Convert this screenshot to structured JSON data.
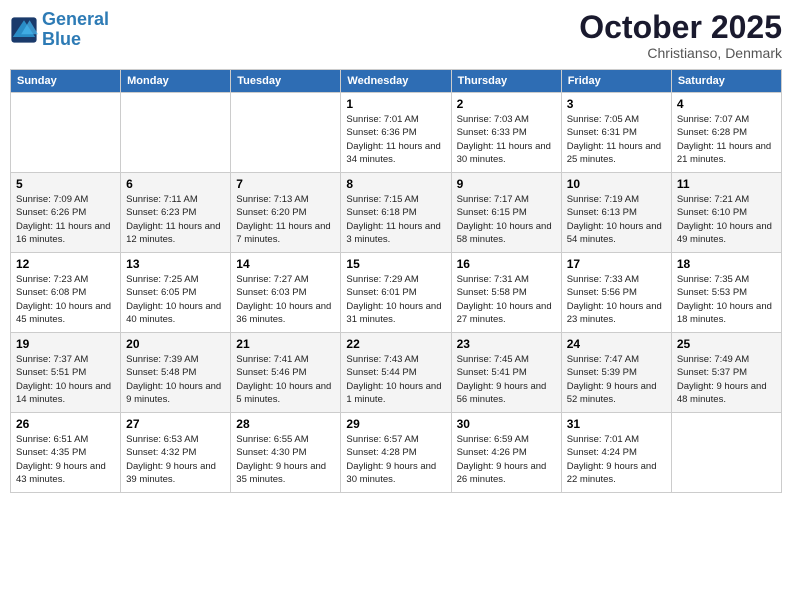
{
  "logo": {
    "line1": "General",
    "line2": "Blue"
  },
  "title": "October 2025",
  "subtitle": "Christianso, Denmark",
  "headers": [
    "Sunday",
    "Monday",
    "Tuesday",
    "Wednesday",
    "Thursday",
    "Friday",
    "Saturday"
  ],
  "weeks": [
    [
      {
        "day": "",
        "info": ""
      },
      {
        "day": "",
        "info": ""
      },
      {
        "day": "",
        "info": ""
      },
      {
        "day": "1",
        "info": "Sunrise: 7:01 AM\nSunset: 6:36 PM\nDaylight: 11 hours\nand 34 minutes."
      },
      {
        "day": "2",
        "info": "Sunrise: 7:03 AM\nSunset: 6:33 PM\nDaylight: 11 hours\nand 30 minutes."
      },
      {
        "day": "3",
        "info": "Sunrise: 7:05 AM\nSunset: 6:31 PM\nDaylight: 11 hours\nand 25 minutes."
      },
      {
        "day": "4",
        "info": "Sunrise: 7:07 AM\nSunset: 6:28 PM\nDaylight: 11 hours\nand 21 minutes."
      }
    ],
    [
      {
        "day": "5",
        "info": "Sunrise: 7:09 AM\nSunset: 6:26 PM\nDaylight: 11 hours\nand 16 minutes."
      },
      {
        "day": "6",
        "info": "Sunrise: 7:11 AM\nSunset: 6:23 PM\nDaylight: 11 hours\nand 12 minutes."
      },
      {
        "day": "7",
        "info": "Sunrise: 7:13 AM\nSunset: 6:20 PM\nDaylight: 11 hours\nand 7 minutes."
      },
      {
        "day": "8",
        "info": "Sunrise: 7:15 AM\nSunset: 6:18 PM\nDaylight: 11 hours\nand 3 minutes."
      },
      {
        "day": "9",
        "info": "Sunrise: 7:17 AM\nSunset: 6:15 PM\nDaylight: 10 hours\nand 58 minutes."
      },
      {
        "day": "10",
        "info": "Sunrise: 7:19 AM\nSunset: 6:13 PM\nDaylight: 10 hours\nand 54 minutes."
      },
      {
        "day": "11",
        "info": "Sunrise: 7:21 AM\nSunset: 6:10 PM\nDaylight: 10 hours\nand 49 minutes."
      }
    ],
    [
      {
        "day": "12",
        "info": "Sunrise: 7:23 AM\nSunset: 6:08 PM\nDaylight: 10 hours\nand 45 minutes."
      },
      {
        "day": "13",
        "info": "Sunrise: 7:25 AM\nSunset: 6:05 PM\nDaylight: 10 hours\nand 40 minutes."
      },
      {
        "day": "14",
        "info": "Sunrise: 7:27 AM\nSunset: 6:03 PM\nDaylight: 10 hours\nand 36 minutes."
      },
      {
        "day": "15",
        "info": "Sunrise: 7:29 AM\nSunset: 6:01 PM\nDaylight: 10 hours\nand 31 minutes."
      },
      {
        "day": "16",
        "info": "Sunrise: 7:31 AM\nSunset: 5:58 PM\nDaylight: 10 hours\nand 27 minutes."
      },
      {
        "day": "17",
        "info": "Sunrise: 7:33 AM\nSunset: 5:56 PM\nDaylight: 10 hours\nand 23 minutes."
      },
      {
        "day": "18",
        "info": "Sunrise: 7:35 AM\nSunset: 5:53 PM\nDaylight: 10 hours\nand 18 minutes."
      }
    ],
    [
      {
        "day": "19",
        "info": "Sunrise: 7:37 AM\nSunset: 5:51 PM\nDaylight: 10 hours\nand 14 minutes."
      },
      {
        "day": "20",
        "info": "Sunrise: 7:39 AM\nSunset: 5:48 PM\nDaylight: 10 hours\nand 9 minutes."
      },
      {
        "day": "21",
        "info": "Sunrise: 7:41 AM\nSunset: 5:46 PM\nDaylight: 10 hours\nand 5 minutes."
      },
      {
        "day": "22",
        "info": "Sunrise: 7:43 AM\nSunset: 5:44 PM\nDaylight: 10 hours\nand 1 minute."
      },
      {
        "day": "23",
        "info": "Sunrise: 7:45 AM\nSunset: 5:41 PM\nDaylight: 9 hours\nand 56 minutes."
      },
      {
        "day": "24",
        "info": "Sunrise: 7:47 AM\nSunset: 5:39 PM\nDaylight: 9 hours\nand 52 minutes."
      },
      {
        "day": "25",
        "info": "Sunrise: 7:49 AM\nSunset: 5:37 PM\nDaylight: 9 hours\nand 48 minutes."
      }
    ],
    [
      {
        "day": "26",
        "info": "Sunrise: 6:51 AM\nSunset: 4:35 PM\nDaylight: 9 hours\nand 43 minutes."
      },
      {
        "day": "27",
        "info": "Sunrise: 6:53 AM\nSunset: 4:32 PM\nDaylight: 9 hours\nand 39 minutes."
      },
      {
        "day": "28",
        "info": "Sunrise: 6:55 AM\nSunset: 4:30 PM\nDaylight: 9 hours\nand 35 minutes."
      },
      {
        "day": "29",
        "info": "Sunrise: 6:57 AM\nSunset: 4:28 PM\nDaylight: 9 hours\nand 30 minutes."
      },
      {
        "day": "30",
        "info": "Sunrise: 6:59 AM\nSunset: 4:26 PM\nDaylight: 9 hours\nand 26 minutes."
      },
      {
        "day": "31",
        "info": "Sunrise: 7:01 AM\nSunset: 4:24 PM\nDaylight: 9 hours\nand 22 minutes."
      },
      {
        "day": "",
        "info": ""
      }
    ]
  ]
}
